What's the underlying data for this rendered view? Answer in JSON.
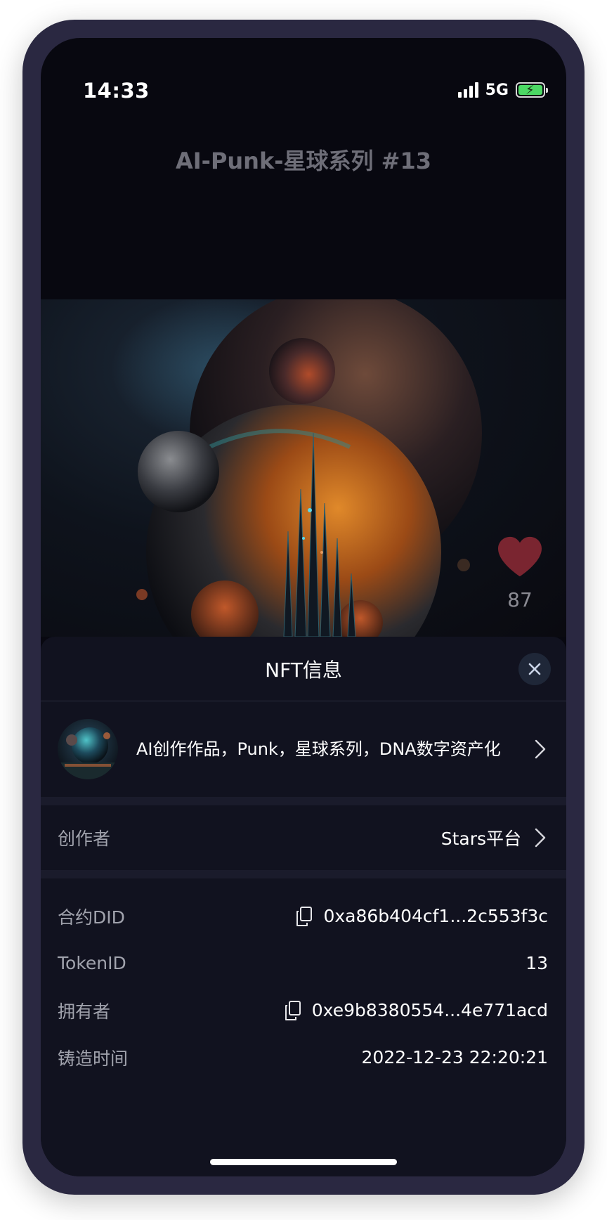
{
  "status_bar": {
    "time": "14:33",
    "network": "5G",
    "icons": [
      "signal-icon",
      "battery-charging-icon"
    ]
  },
  "page": {
    "title": "AI-Punk-星球系列 #13"
  },
  "artwork": {
    "like_count": "87",
    "like_color": "#7a2530"
  },
  "sheet": {
    "title": "NFT信息",
    "collection": {
      "description": "AI创作作品，Punk，星球系列，DNA数字资产化"
    },
    "creator": {
      "label": "创作者",
      "value": "Stars平台"
    },
    "info": {
      "contract_did_label": "合约DID",
      "contract_did_value": "0xa86b404cf1...2c553f3c",
      "token_id_label": "TokenID",
      "token_id_value": "13",
      "owner_label": "拥有者",
      "owner_value": "0xe9b8380554...4e771acd",
      "minted_label": "铸造时间",
      "minted_value": "2022-12-23 22:20:21"
    }
  },
  "colors": {
    "screen_bg": "#080810",
    "sheet_bg": "#11121f",
    "label_gray": "#a1a3ad",
    "battery_green": "#4cd964"
  }
}
